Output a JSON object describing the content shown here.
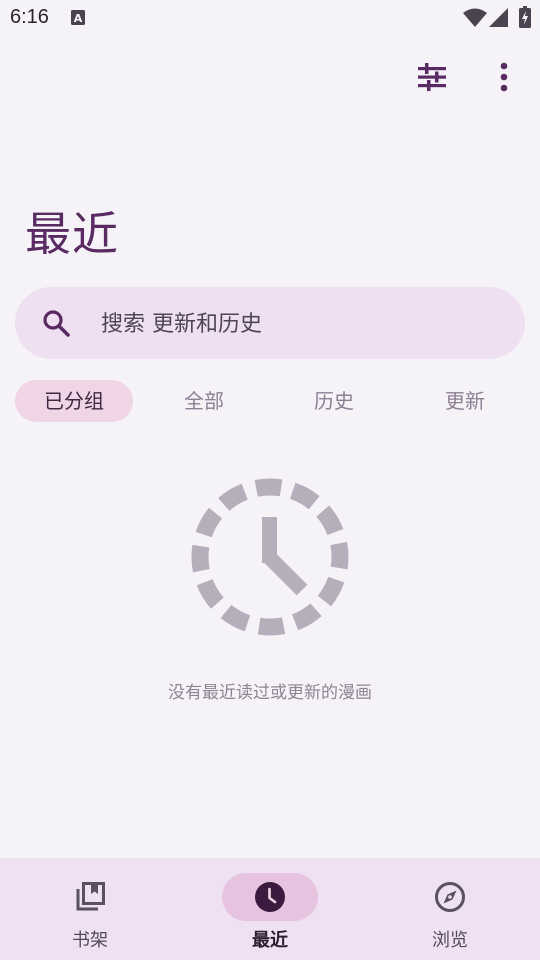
{
  "status_bar": {
    "time": "6:16",
    "indicator_letter": "A",
    "icons": [
      "a-indicator-icon",
      "wifi-icon",
      "signal-icon",
      "battery-icon"
    ]
  },
  "toolbar": {
    "icons": [
      "tune-icon",
      "more-vert-icon"
    ]
  },
  "page": {
    "title": "最近"
  },
  "search": {
    "placeholder": "搜索 更新和历史",
    "value": "",
    "icon": "search-icon"
  },
  "tabs": [
    {
      "label": "已分组",
      "selected": true
    },
    {
      "label": "全部",
      "selected": false
    },
    {
      "label": "历史",
      "selected": false
    },
    {
      "label": "更新",
      "selected": false
    }
  ],
  "empty_state": {
    "icon": "clock-icon",
    "message": "没有最近读过或更新的漫画"
  },
  "bottom_nav": [
    {
      "label": "书架",
      "icon": "library-icon",
      "selected": false
    },
    {
      "label": "最近",
      "icon": "clock-icon",
      "selected": true
    },
    {
      "label": "浏览",
      "icon": "compass-icon",
      "selected": false
    }
  ],
  "colors": {
    "background": "#f6f3f8",
    "accent": "#5a2a63",
    "search_bg": "#eee0f1",
    "chip_selected": "#f0d5e6",
    "nav_bg": "#efe1f2",
    "nav_pill": "#e6c4e0",
    "muted_icon": "#b7aebb"
  }
}
